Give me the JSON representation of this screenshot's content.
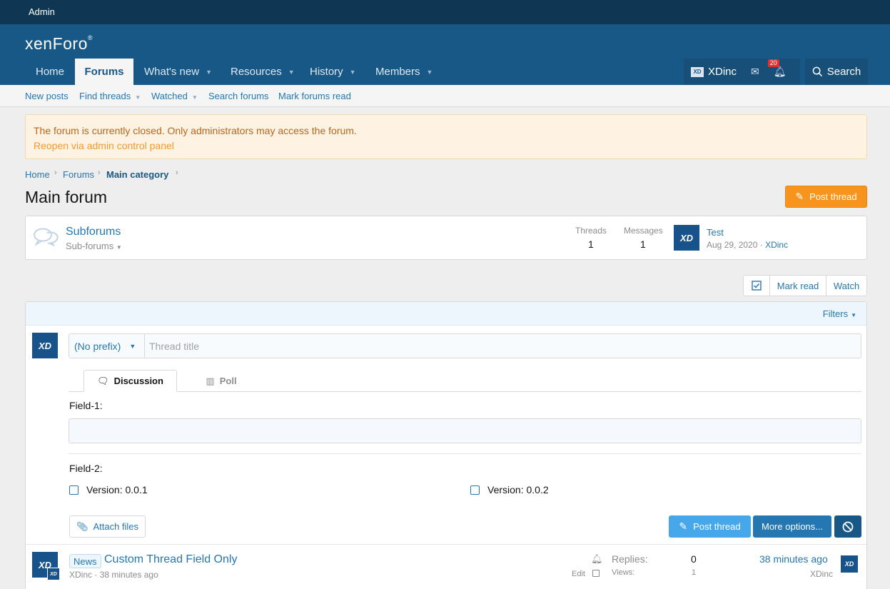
{
  "admin_bar": {
    "label": "Admin"
  },
  "header": {
    "logo": "xenForo",
    "logo_mark": "®",
    "tabs": [
      {
        "label": "Home",
        "has_caret": false
      },
      {
        "label": "Forums",
        "has_caret": false,
        "active": true
      },
      {
        "label": "What's new",
        "has_caret": true
      },
      {
        "label": "Resources",
        "has_caret": true
      },
      {
        "label": "History",
        "has_caret": true
      },
      {
        "label": "Members",
        "has_caret": true
      }
    ],
    "user": {
      "avatar_text": "XD",
      "name": "XDinc"
    },
    "notification_count": "20",
    "search_label": "Search"
  },
  "subnav": {
    "items": [
      {
        "label": "New posts"
      },
      {
        "label": "Find threads"
      },
      {
        "label": "Watched"
      },
      {
        "label": "Search forums"
      },
      {
        "label": "Mark forums read"
      }
    ]
  },
  "notice": {
    "text": "The forum is currently closed. Only administrators may access the forum.",
    "link": "Reopen via admin control panel"
  },
  "breadcrumb": [
    "Home",
    "Forums",
    "Main category"
  ],
  "page": {
    "title": "Main forum",
    "post_thread_label": "Post thread"
  },
  "subforum": {
    "title": "Subforums",
    "sub_label": "Sub-forums",
    "threads_label": "Threads",
    "threads_value": "1",
    "messages_label": "Messages",
    "messages_value": "1",
    "last_post_title": "Test",
    "last_post_date": "Aug 29, 2020",
    "last_post_user": "XDinc",
    "avatar_text": "XD"
  },
  "actions": {
    "mark_read": "Mark read",
    "watch": "Watch"
  },
  "filters": {
    "label": "Filters"
  },
  "composer": {
    "avatar_text": "XD",
    "prefix": "(No prefix)",
    "title_placeholder": "Thread title",
    "tabs": [
      "Discussion",
      "Poll"
    ],
    "field1_label": "Field-1:",
    "field2_label": "Field-2:",
    "options": [
      "Version: 0.0.1",
      "Version: 0.0.2"
    ],
    "attach_label": "Attach files",
    "post_label": "Post thread",
    "more_label": "More options..."
  },
  "thread": {
    "prefix": "News",
    "title": "Custom Thread Field Only",
    "author": "XDinc",
    "time": "38 minutes ago",
    "edit_label": "Edit",
    "replies_label": "Replies:",
    "replies_value": "0",
    "views_label": "Views:",
    "views_value": "1",
    "last_time": "38 minutes ago",
    "last_user": "XDinc",
    "avatar_text": "XD"
  }
}
